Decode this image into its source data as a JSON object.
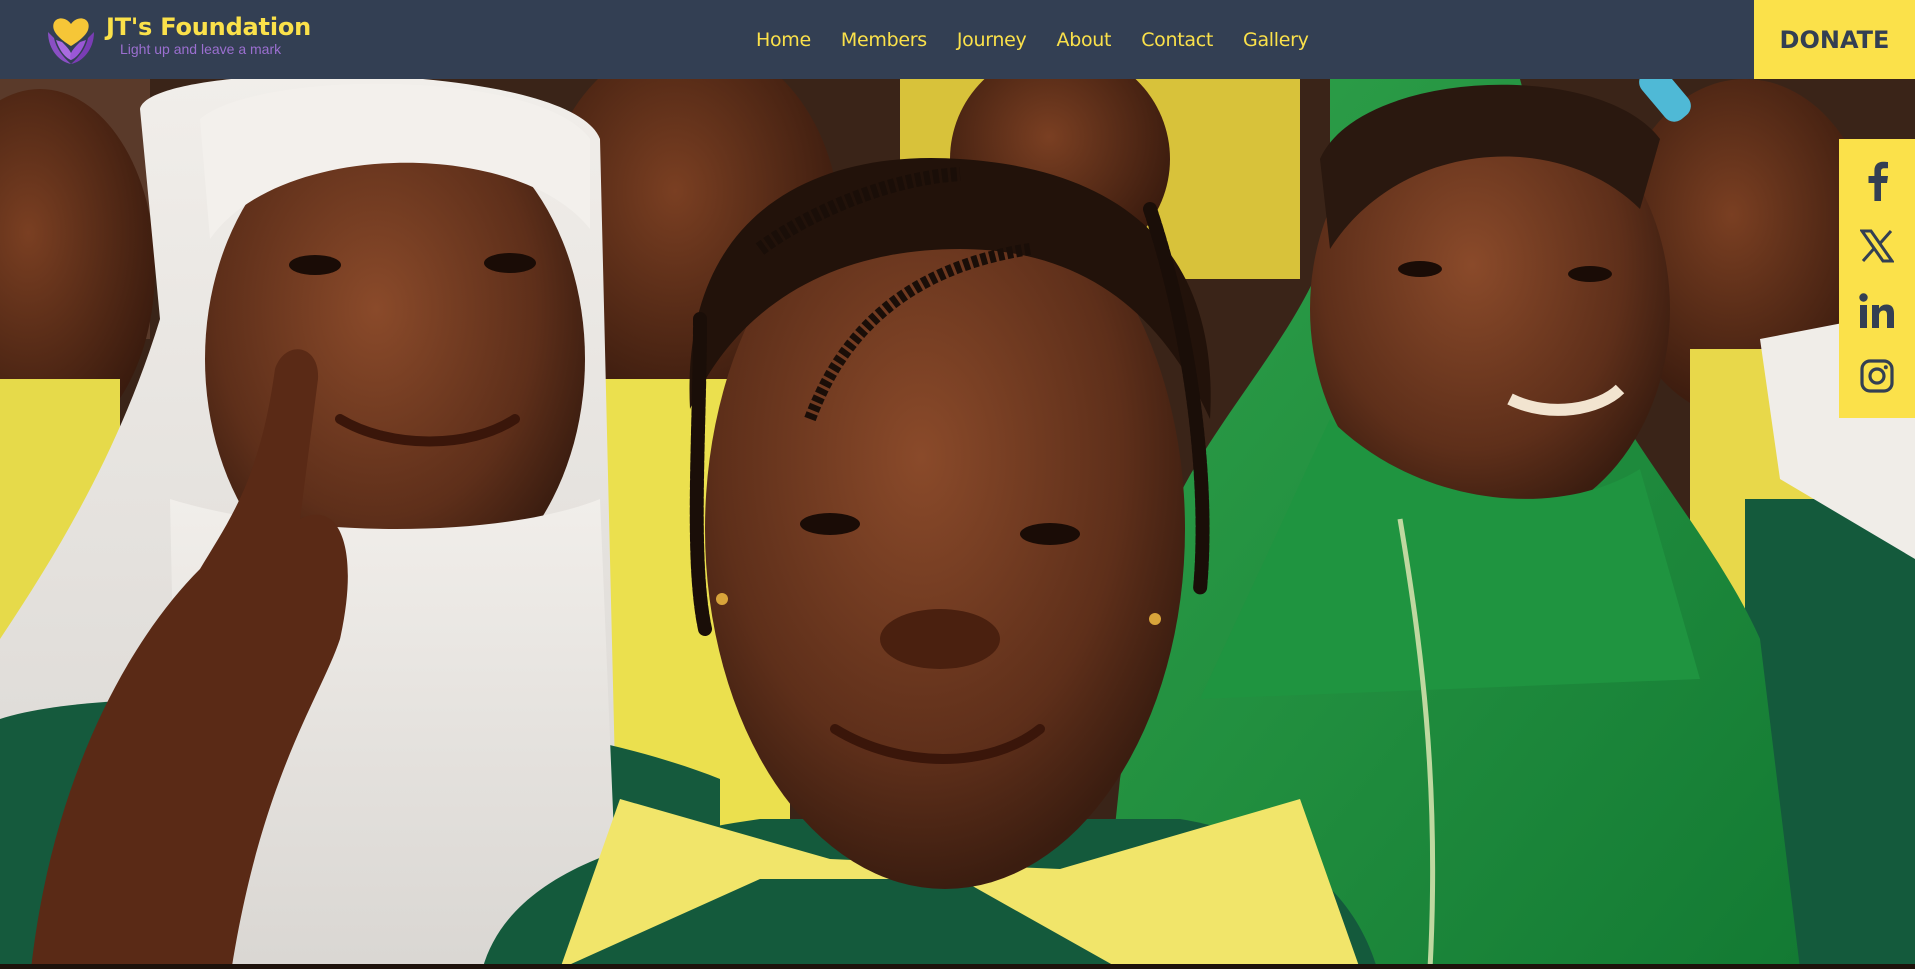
{
  "brand": {
    "name": "JT's Foundation",
    "tagline": "Light up and leave a mark",
    "logo_icon": "heart-hands-logo"
  },
  "nav": {
    "items": [
      "Home",
      "Members",
      "Journey",
      "About",
      "Contact",
      "Gallery"
    ]
  },
  "donate_label": "DONATE",
  "hero": {
    "image_subject": "children-in-school-uniforms-photo"
  },
  "social": {
    "icons": [
      "facebook-icon",
      "x-icon",
      "linkedin-icon",
      "instagram-icon"
    ]
  },
  "colors": {
    "header_bg": "#333f53",
    "accent_yellow": "#fbe14a",
    "tagline_purple": "#9b6fd0"
  }
}
